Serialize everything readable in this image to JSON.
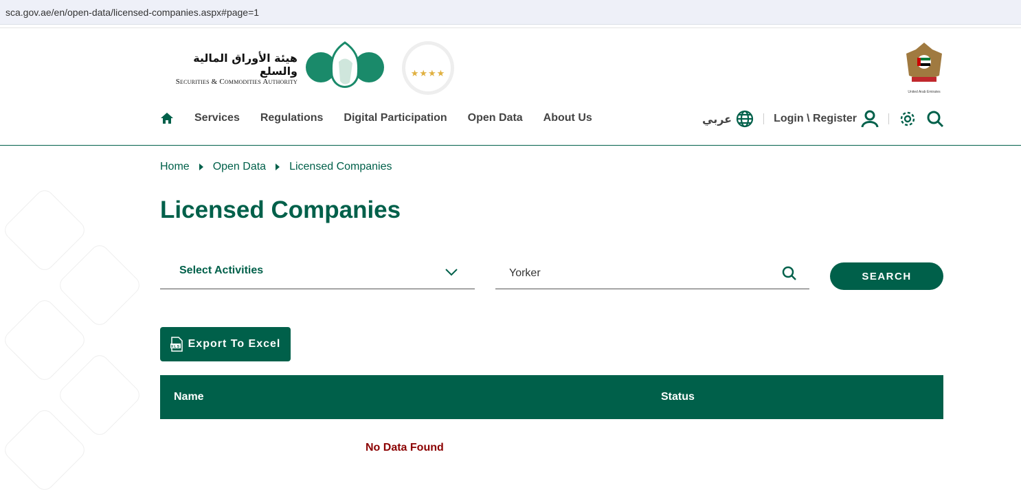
{
  "browser": {
    "url": "sca.gov.ae/en/open-data/licensed-companies.aspx#page=1"
  },
  "logo": {
    "arabic": "هيئة الأوراق المالية والسلع",
    "english": "Securities & Commodities Authority"
  },
  "uae_emblem": {
    "caption": "United Arab Emirates"
  },
  "nav": {
    "items": [
      "Services",
      "Regulations",
      "Digital Participation",
      "Open Data",
      "About Us"
    ],
    "language": "عربي",
    "login": "Login \\ Register"
  },
  "breadcrumb": [
    "Home",
    "Open Data",
    "Licensed Companies"
  ],
  "page_title": "Licensed Companies",
  "filters": {
    "activities_placeholder": "Select Activities",
    "search_value": "Yorker",
    "search_button": "SEARCH"
  },
  "export_button": "Export To Excel",
  "table": {
    "columns": [
      "Name",
      "Status"
    ],
    "empty_message": "No Data Found"
  },
  "colors": {
    "brand": "#00604a",
    "error": "#8b0000"
  }
}
